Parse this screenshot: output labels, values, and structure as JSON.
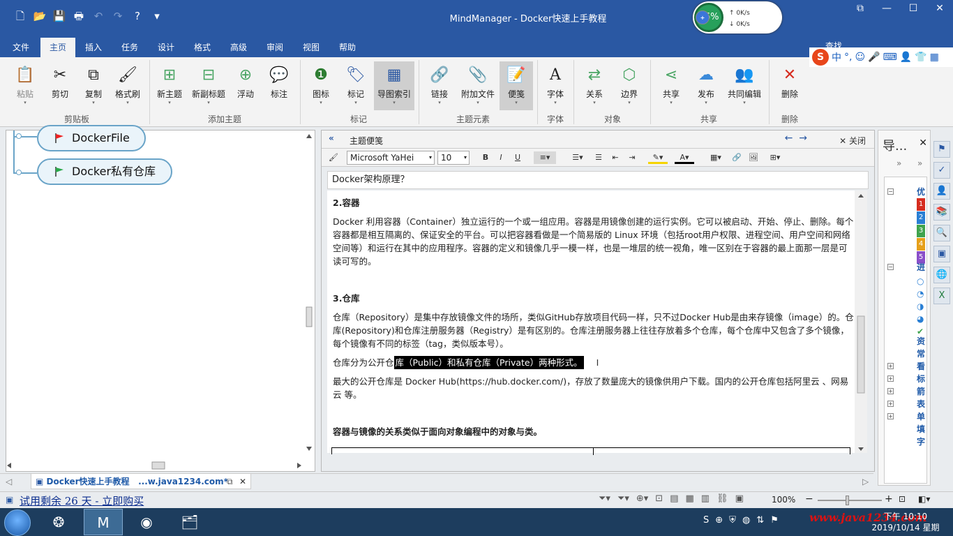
{
  "window": {
    "title": "MindManager - Docker快速上手教程",
    "speed": {
      "percent": "26%",
      "up": "0K/s",
      "down": "0K/s"
    }
  },
  "menu": {
    "tabs": [
      "文件",
      "主页",
      "插入",
      "任务",
      "设计",
      "格式",
      "高级",
      "审阅",
      "视图",
      "帮助"
    ],
    "active": "主页",
    "find": "查找"
  },
  "ime": {
    "label": "中"
  },
  "ribbon": {
    "buttons": [
      {
        "label": "粘贴",
        "icon": "paste-icon"
      },
      {
        "label": "剪切",
        "icon": "scissors-icon"
      },
      {
        "label": "复制",
        "icon": "copy-icon"
      },
      {
        "label": "格式刷",
        "icon": "format-painter-icon"
      },
      {
        "label": "新主题",
        "icon": "new-topic-icon"
      },
      {
        "label": "新副标题",
        "icon": "new-subtopic-icon"
      },
      {
        "label": "浮动",
        "icon": "floating-topic-icon"
      },
      {
        "label": "标注",
        "icon": "callout-icon"
      },
      {
        "label": "图标",
        "icon": "icon-marker-icon"
      },
      {
        "label": "标记",
        "icon": "tag-icon"
      },
      {
        "label": "导图索引",
        "icon": "map-index-icon"
      },
      {
        "label": "链接",
        "icon": "link-icon"
      },
      {
        "label": "附加文件",
        "icon": "attachment-icon"
      },
      {
        "label": "便笺",
        "icon": "notes-icon"
      },
      {
        "label": "字体",
        "icon": "font-icon"
      },
      {
        "label": "关系",
        "icon": "relationship-icon"
      },
      {
        "label": "边界",
        "icon": "boundary-icon"
      },
      {
        "label": "共享",
        "icon": "share-icon"
      },
      {
        "label": "发布",
        "icon": "publish-icon"
      },
      {
        "label": "共同编辑",
        "icon": "coedit-icon"
      },
      {
        "label": "删除",
        "icon": "delete-icon"
      }
    ],
    "groups": [
      "剪贴板",
      "添加主题",
      "标记",
      "主题元素",
      "字体",
      "对象",
      "共享",
      "删除"
    ]
  },
  "map": {
    "nodes": [
      "DockerFile",
      "Docker私有仓库"
    ]
  },
  "doc_tab": {
    "name": "Docker快速上手教程",
    "path": "...w.java1234.com*"
  },
  "notes": {
    "header": "主题便笺",
    "close": "关闭",
    "font": "Microsoft YaHei",
    "size": "10",
    "title": "Docker架构原理？",
    "h_container": "2.容器",
    "p_container": "Docker 利用容器（Container）独立运行的一个或一组应用。容器是用镜像创建的运行实例。它可以被启动、开始、停止、删除。每个容器都是相互隔离的、保证安全的平台。可以把容器看做是一个简易版的 Linux 环境（包括root用户权限、进程空间、用户空间和网络空间等）和运行在其中的应用程序。容器的定义和镜像几乎一模一样，也是一堆层的统一视角，唯一区别在于容器的最上面那一层是可读可写的。",
    "h_repo": "3.仓库",
    "p_repo": "仓库（Repository）是集中存放镜像文件的场所，类似GitHub存放项目代码一样，只不过Docker Hub是由来存镜像（image）的。仓库(Repository)和仓库注册服务器（Registry）是有区别的。仓库注册服务器上往往存放着多个仓库，每个仓库中又包含了多个镜像，每个镜像有不同的标签（tag，类似版本号）。",
    "p_split_pre": "仓库分为公开仓",
    "p_split_hl": "库（Public）和私有仓库（Private）两种形式。",
    "p_hub": "最大的公开仓库是 Docker Hub(https://hub.docker.com/)，存放了数量庞大的镜像供用户下载。国内的公开仓库包括阿里云 、网易云 等。",
    "h_relation": "容器与镜像的关系类似于面向对象编程中的对象与类。"
  },
  "nav": {
    "title": "导...",
    "items": [
      "优",
      "进",
      "资",
      "常",
      "看",
      "标",
      "箭",
      "表",
      "单",
      "填",
      "字"
    ]
  },
  "status": {
    "trial": "试用剩余 26 天 - 立即购买",
    "zoom": "100%"
  },
  "taskbar": {
    "time": "下午 10:10",
    "date": "2019/10/14 星期一",
    "watermark": "www.java1234.com"
  }
}
